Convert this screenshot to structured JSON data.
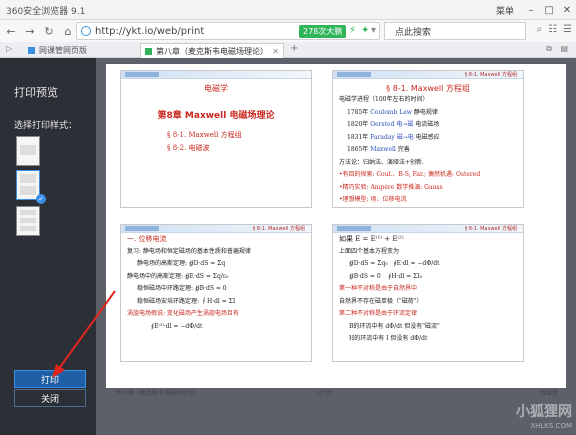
{
  "browser": {
    "title": "360安全浏览器 9.1",
    "menu_label": "菜单",
    "url": "http://ykt.io/web/print",
    "badge": "278次大鹏",
    "search_placeholder": "点此搜索"
  },
  "tabs": [
    {
      "label": "网课管网页版"
    },
    {
      "label": "第八章（麦克斯韦电磁场理论）"
    }
  ],
  "sidebar": {
    "title": "打印预览",
    "style_label": "选择打印样式：",
    "print_button": "打印",
    "close_button": "关闭"
  },
  "slides": {
    "s1": {
      "head": "电磁学",
      "title": "第8章 Maxwell 电磁场理论",
      "items": [
        "§ 8-1. Maxwell 方程组",
        "§ 8-2. 电磁波"
      ]
    },
    "s2": {
      "head": "§ 8-1. Maxwell 方程组",
      "sub": "电磁学进程（100年左右的时间）",
      "rows": [
        [
          "1785年",
          "Coulomb Law",
          "静电规律"
        ],
        [
          "1820年",
          "Oersted  电→磁",
          "电流磁场"
        ],
        [
          "1831年",
          "Faraday  磁→电",
          "电磁感应"
        ],
        [
          "1865年",
          "Maxwell",
          "完善"
        ]
      ],
      "lines": [
        "方法论：归纳法、演绎法+创新.",
        "•有目的探索: Coul.、B-S, Far.;",
        "偶然机遇: Ostered",
        "•精巧实验: Ampère",
        "数学推演: Gauss",
        "•理想模型: 场、位移电流"
      ]
    },
    "s3": {
      "head": "§ 8-1. Maxwell 方程组",
      "lines": [
        "一. 位移电流",
        "复习: 静电场和恒定磁场的基本性质和普遍规律",
        "静电场的高斯定理:",
        "静电场中的高斯定理:",
        "稳恒磁场中环路定理:",
        "稳恒磁场安培环路定理:",
        "涡旋电场假说: 变化磁场产生涡旋电场且有"
      ]
    },
    "s4": {
      "head": "§ 8-1. Maxwell 方程组",
      "lines": [
        "如果  E = E⁽¹⁾ + E⁽²⁾",
        "上面四个基本方程变为",
        "第一种不对称是由于自然界中",
        "自然界不存在磁单极（\"磁荷\"）",
        "第二种不对称是由于环流定律",
        "B的环流中有 dΦ/dt 但没有\"磁流\"",
        "H的环流中有 I 但没有 dΦ/dt"
      ]
    }
  },
  "footer": {
    "left": "第八章（麦克斯韦电磁场理论）",
    "page": "1/7页",
    "brand": "雨课堂"
  },
  "watermark": {
    "big": "小狐狸网",
    "small": "XHLKS.COM"
  },
  "colors": {
    "accent": "#3b8fe3",
    "sidebar_bg": "#2c2f36",
    "slide_red": "#c8281f",
    "slide_blue": "#2a4fb5",
    "annotation_red": "#e0261e"
  }
}
